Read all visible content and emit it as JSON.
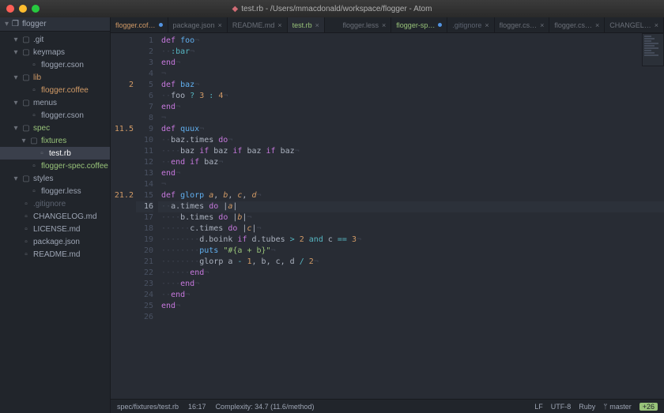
{
  "window": {
    "title": "test.rb - /Users/mmacdonald/workspace/flogger - Atom",
    "file_icon_color": "#d06c75"
  },
  "project": {
    "root": "flogger"
  },
  "tree": [
    {
      "pad": 1,
      "chev": "▾",
      "type": "folder",
      "label": ".git",
      "status": "git"
    },
    {
      "pad": 1,
      "chev": "▾",
      "type": "folder",
      "label": "keymaps",
      "status": ""
    },
    {
      "pad": 2,
      "chev": "",
      "type": "file",
      "label": "flogger.cson",
      "status": ""
    },
    {
      "pad": 1,
      "chev": "▾",
      "type": "folder",
      "label": "lib",
      "status": "mod"
    },
    {
      "pad": 2,
      "chev": "",
      "type": "file",
      "label": "flogger.coffee",
      "status": "mod"
    },
    {
      "pad": 1,
      "chev": "▾",
      "type": "folder",
      "label": "menus",
      "status": ""
    },
    {
      "pad": 2,
      "chev": "",
      "type": "file",
      "label": "flogger.cson",
      "status": ""
    },
    {
      "pad": 1,
      "chev": "▾",
      "type": "folder",
      "label": "spec",
      "status": "new"
    },
    {
      "pad": 2,
      "chev": "▾",
      "type": "folder",
      "label": "fixtures",
      "status": "new"
    },
    {
      "pad": 3,
      "chev": "",
      "type": "file",
      "label": "test.rb",
      "status": "new",
      "selected": true
    },
    {
      "pad": 2,
      "chev": "",
      "type": "file",
      "label": "flogger-spec.coffee",
      "status": "new"
    },
    {
      "pad": 1,
      "chev": "▾",
      "type": "folder",
      "label": "styles",
      "status": ""
    },
    {
      "pad": 2,
      "chev": "",
      "type": "file",
      "label": "flogger.less",
      "status": ""
    },
    {
      "pad": 1,
      "chev": "",
      "type": "file",
      "label": ".gitignore",
      "status": "ign"
    },
    {
      "pad": 1,
      "chev": "",
      "type": "file",
      "label": "CHANGELOG.md",
      "status": ""
    },
    {
      "pad": 1,
      "chev": "",
      "type": "file",
      "label": "LICENSE.md",
      "status": ""
    },
    {
      "pad": 1,
      "chev": "",
      "type": "file",
      "label": "package.json",
      "status": ""
    },
    {
      "pad": 1,
      "chev": "",
      "type": "file",
      "label": "README.md",
      "status": ""
    }
  ],
  "tabs": [
    {
      "label": "flogger.cof…",
      "status": "mod",
      "modified": true
    },
    {
      "label": "package.json",
      "status": ""
    },
    {
      "label": "README.md",
      "status": ""
    },
    {
      "label": "test.rb",
      "status": "new",
      "active": true
    },
    {
      "label": "",
      "status": "",
      "spacer": true
    },
    {
      "label": "flogger.less",
      "status": ""
    },
    {
      "label": "flogger-sp…",
      "status": "new",
      "modified": true
    },
    {
      "label": ".gitignore",
      "status": "ign"
    },
    {
      "label": "flogger.cs…",
      "status": ""
    },
    {
      "label": "flogger.cs…",
      "status": ""
    },
    {
      "label": "CHANGEL…",
      "status": ""
    }
  ],
  "complexity": {
    "5": "2",
    "9": "11.5",
    "15": "21.2"
  },
  "cursor_line": 16,
  "code": [
    {
      "n": 1,
      "html": "<span class='kw'>def</span> <span class='def'>foo</span><span class='invn'>¬</span>"
    },
    {
      "n": 2,
      "html": "<span class='inv'></span><span class='inv'></span><span class='sym'>:bar</span><span class='invn'>¬</span>"
    },
    {
      "n": 3,
      "html": "<span class='kw'>end</span><span class='invn'>¬</span>"
    },
    {
      "n": 4,
      "html": "<span class='invn'>¬</span>"
    },
    {
      "n": 5,
      "html": "<span class='kw'>def</span> <span class='def'>baz</span><span class='invn'>¬</span>"
    },
    {
      "n": 6,
      "html": "<span class='inv'></span><span class='inv'></span>foo <span class='op'>?</span> <span class='num'>3</span> <span class='op'>:</span> <span class='num'>4</span><span class='invn'>¬</span>"
    },
    {
      "n": 7,
      "html": "<span class='kw'>end</span><span class='invn'>¬</span>"
    },
    {
      "n": 8,
      "html": "<span class='invn'>¬</span>"
    },
    {
      "n": 9,
      "html": "<span class='kw'>def</span> <span class='def'>quux</span><span class='invn'>¬</span>"
    },
    {
      "n": 10,
      "html": "<span class='inv'></span><span class='inv'></span>baz.times <span class='kw'>do</span><span class='invn'>¬</span>"
    },
    {
      "n": 11,
      "html": "<span class='inv'></span><span class='inv'></span><span class='inv'></span><span class='inv'></span>baz <span class='kw'>if</span> baz <span class='kw'>if</span> baz <span class='kw'>if</span> baz<span class='invn'>¬</span>"
    },
    {
      "n": 12,
      "html": "<span class='inv'></span><span class='inv'></span><span class='kw'>end</span> <span class='kw'>if</span> baz<span class='invn'>¬</span>"
    },
    {
      "n": 13,
      "html": "<span class='kw'>end</span><span class='invn'>¬</span>"
    },
    {
      "n": 14,
      "html": "<span class='invn'>¬</span>"
    },
    {
      "n": 15,
      "html": "<span class='kw'>def</span> <span class='def'>glorp</span> <span class='param'>a</span>, <span class='param'>b</span>, <span class='param'>c</span>, <span class='param'>d</span><span class='invn'>¬</span>"
    },
    {
      "n": 16,
      "html": "<span class='inv'></span><span class='inv'></span>a.times <span class='kw'>do</span> |<span class='param'>a</span>|"
    },
    {
      "n": 17,
      "html": "<span class='inv'></span><span class='inv'></span><span class='inv'></span><span class='inv'></span>b.times <span class='kw'>do</span> |<span class='param'>b</span>|<span class='invn'>¬</span>"
    },
    {
      "n": 18,
      "html": "<span class='inv'></span><span class='inv'></span><span class='inv'></span><span class='inv'></span><span class='inv'></span><span class='inv'></span>c.times <span class='kw'>do</span> |<span class='param'>c</span>|<span class='invn'>¬</span>"
    },
    {
      "n": 19,
      "html": "<span class='inv'></span><span class='inv'></span><span class='inv'></span><span class='inv'></span><span class='inv'></span><span class='inv'></span><span class='inv'></span><span class='inv'></span>d.boink <span class='kw'>if</span> d.tubes <span class='op'>&gt;</span> <span class='num'>2</span> <span class='op'>and</span> c <span class='op'>==</span> <span class='num'>3</span><span class='invn'>¬</span>"
    },
    {
      "n": 20,
      "html": "<span class='inv'></span><span class='inv'></span><span class='inv'></span><span class='inv'></span><span class='inv'></span><span class='inv'></span><span class='inv'></span><span class='inv'></span><span class='def'>puts</span> <span class='str'>\"#{a + b}\"</span><span class='invn'>¬</span>"
    },
    {
      "n": 21,
      "html": "<span class='inv'></span><span class='inv'></span><span class='inv'></span><span class='inv'></span><span class='inv'></span><span class='inv'></span><span class='inv'></span><span class='inv'></span>glorp a <span class='op'>-</span> <span class='num'>1</span>, b, c, d <span class='op'>/</span> <span class='num'>2</span><span class='invn'>¬</span>"
    },
    {
      "n": 22,
      "html": "<span class='inv'></span><span class='inv'></span><span class='inv'></span><span class='inv'></span><span class='inv'></span><span class='inv'></span><span class='kw'>end</span><span class='invn'>¬</span>"
    },
    {
      "n": 23,
      "html": "<span class='inv'></span><span class='inv'></span><span class='inv'></span><span class='inv'></span><span class='kw'>end</span><span class='invn'>¬</span>"
    },
    {
      "n": 24,
      "html": "<span class='inv'></span><span class='inv'></span><span class='kw'>end</span><span class='invn'>¬</span>"
    },
    {
      "n": 25,
      "html": "<span class='kw'>end</span><span class='invn'>¬</span>"
    },
    {
      "n": 26,
      "html": ""
    }
  ],
  "status": {
    "path": "spec/fixtures/test.rb",
    "cursor": "16:17",
    "complexity": "Complexity: 34.7 (11.6/method)",
    "eol": "LF",
    "encoding": "UTF-8",
    "grammar": "Ruby",
    "branch": "master",
    "diff": "+26"
  }
}
